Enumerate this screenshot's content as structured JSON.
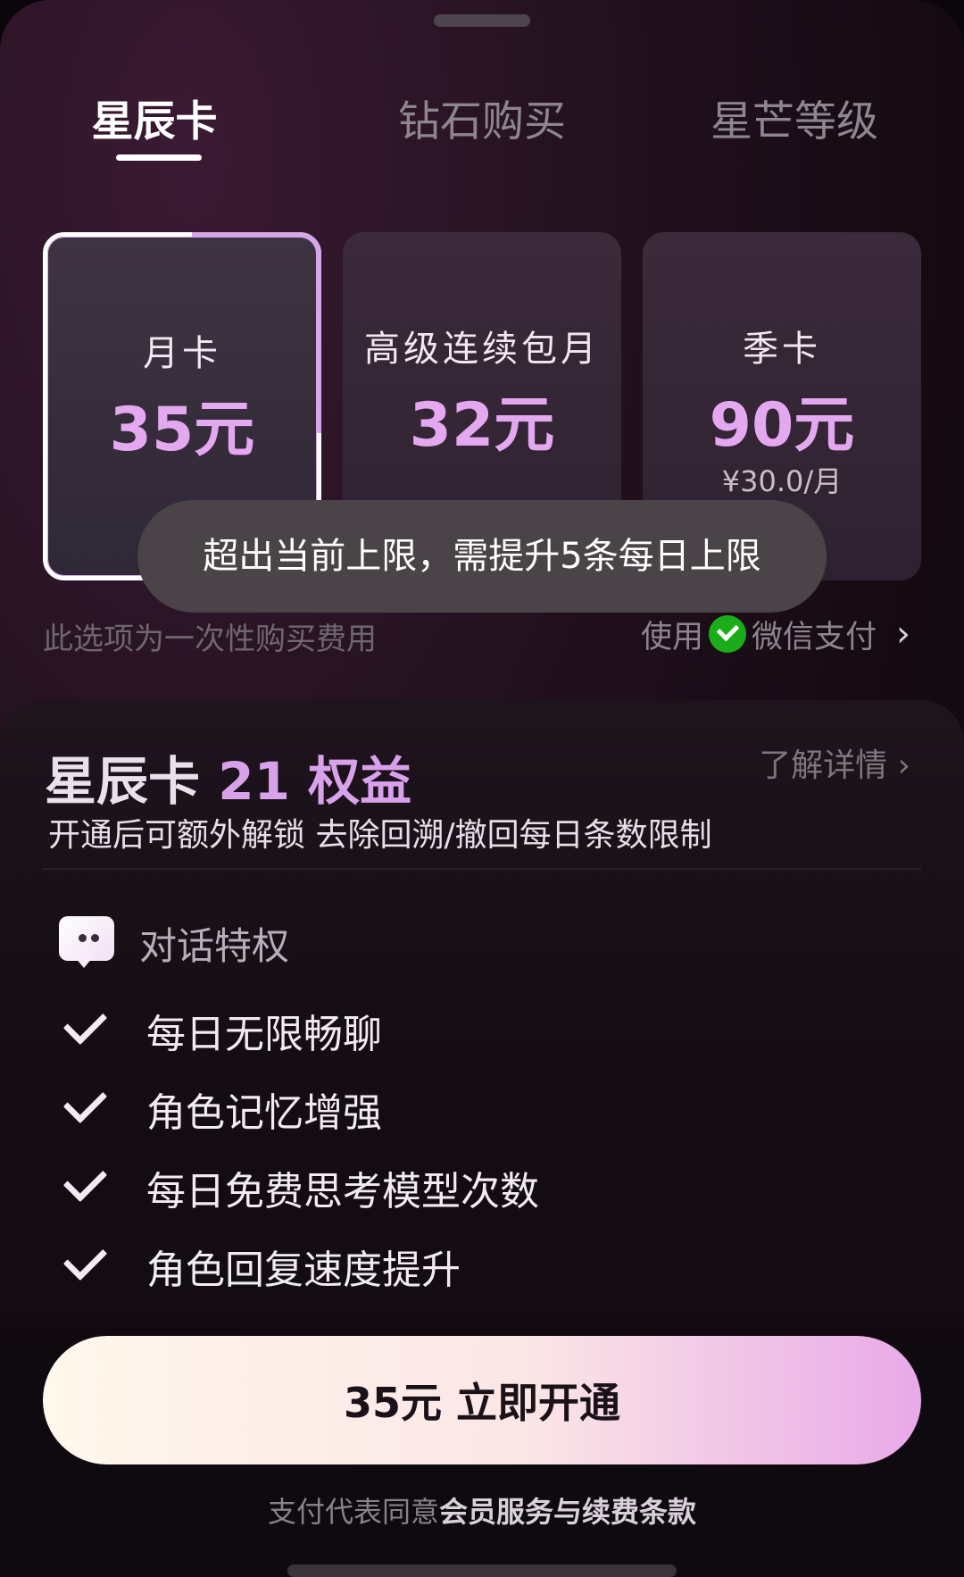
{
  "tabs": [
    {
      "label": "星辰卡",
      "active": true
    },
    {
      "label": "钻石购买",
      "active": false
    },
    {
      "label": "星芒等级",
      "active": false
    }
  ],
  "plans": [
    {
      "name": "月卡",
      "price": "35元",
      "sub": "",
      "selected": true
    },
    {
      "name": "高级连续包月",
      "price": "32元",
      "sub": "",
      "selected": false
    },
    {
      "name": "季卡",
      "price": "90元",
      "sub": "¥30.0/月",
      "selected": false
    }
  ],
  "toast": "超出当前上限，需提升5条每日上限",
  "purchase_note": "此选项为一次性购买费用",
  "payment": {
    "prefix": "使用",
    "method": "微信支付"
  },
  "benefits": {
    "title_prefix": "星辰卡",
    "title_count": "21",
    "title_suffix": "权益",
    "more": "了解详情",
    "description": "开通后可额外解锁 去除回溯/撤回每日条数限制",
    "category": "对话特权",
    "items": [
      "每日无限畅聊",
      "角色记忆增强",
      "每日免费思考模型次数",
      "角色回复速度提升"
    ]
  },
  "cta": "35元 立即开通",
  "terms": {
    "prefix": "支付代表同意",
    "link": "会员服务与续费条款"
  },
  "colors": {
    "accent": "#e4a8f0",
    "wechat": "#1aad19"
  }
}
